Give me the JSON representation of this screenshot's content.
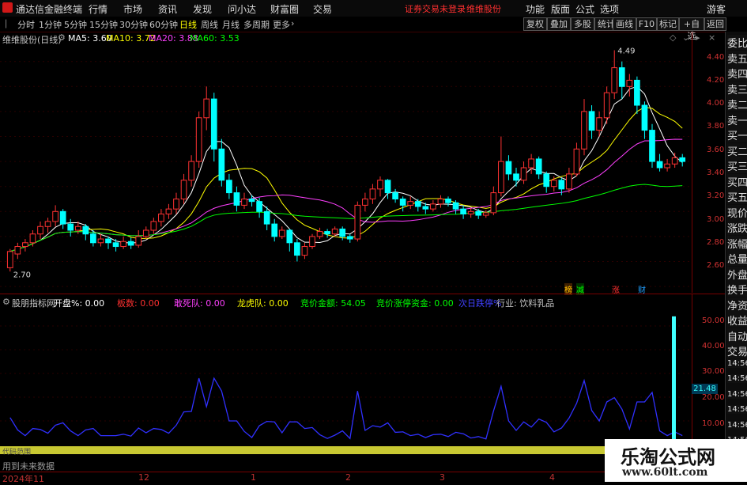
{
  "titlebar": {
    "app_name": "通达信金融终端",
    "menu": [
      "行情",
      "市场",
      "资讯",
      "发现",
      "问小达",
      "财富圈",
      "交易"
    ],
    "warning": "证券交易未登录",
    "stock": "维维股份",
    "right_menu": [
      "功能",
      "版面",
      "公式",
      "选项"
    ],
    "guest": "游客"
  },
  "toolbar": {
    "periods": [
      "分时",
      "1分钟",
      "5分钟",
      "15分钟",
      "30分钟",
      "60分钟",
      "日线",
      "周线",
      "月线",
      "多周期",
      "更多"
    ],
    "active": "日线",
    "right_buttons": [
      "复权",
      "叠加",
      "多股",
      "统计",
      "画线",
      "F10",
      "标记",
      "+自选",
      "返回"
    ]
  },
  "main_chart": {
    "title": "维维股份(日线)",
    "ma_labels": [
      {
        "text": "MA5: 3.60",
        "color": "#ffffff"
      },
      {
        "text": "MA10: 3.72",
        "color": "#ffff00"
      },
      {
        "text": "MA20: 3.88",
        "color": "#ff40ff"
      },
      {
        "text": "MA60: 3.53",
        "color": "#00ff00"
      }
    ],
    "high_label": "4.49",
    "low_label": "2.70",
    "price_axis": [
      "4.40",
      "4.20",
      "4.00",
      "3.80",
      "3.60",
      "3.40",
      "3.20",
      "3.00",
      "2.80",
      "2.60"
    ],
    "event_marks": [
      {
        "text": "榜",
        "color": "#ffc000"
      },
      {
        "text": "减",
        "color": "#00ff00"
      },
      {
        "text": "涨",
        "color": "#ff3030"
      },
      {
        "text": "财",
        "color": "#20a0ff"
      }
    ]
  },
  "right_panel": {
    "labels": [
      "委比",
      "卖五",
      "卖四",
      "卖三",
      "卖二",
      "卖一",
      "买一",
      "买二",
      "买三",
      "买四",
      "买五",
      "现价",
      "涨跌",
      "涨幅",
      "总量",
      "外盘",
      "换手",
      "净资",
      "收益",
      "自动",
      "交易",
      "14:56",
      "14:56",
      "14:56",
      "14:56",
      "14:56",
      "14:56",
      "14:56",
      "14:56"
    ]
  },
  "sub_chart": {
    "title": "股朋指标网",
    "fields": [
      {
        "text": "开盘%: 0.00",
        "color": "#ffffff"
      },
      {
        "text": "板数: 0.00",
        "color": "#ff3030"
      },
      {
        "text": "敢死队: 0.00",
        "color": "#ff40ff"
      },
      {
        "text": "龙虎队: 0.00",
        "color": "#ffff00"
      },
      {
        "text": "竞价金额: 54.05",
        "color": "#00ff00"
      },
      {
        "text": "竞价涨停资金: 0.00",
        "color": "#00ff00"
      },
      {
        "text": "次日跌停%",
        "color": "#4040ff"
      },
      {
        "text": "行业: 饮料乳品",
        "color": "#c0c0c0"
      }
    ],
    "axis": [
      "50.00",
      "40.00",
      "30.00",
      "20.00",
      "10.00"
    ],
    "current_value": "21.48",
    "strip_label": "代码范围",
    "future_note": "用到未来数据"
  },
  "x_axis": {
    "labels": [
      "2024年11",
      "12",
      "1",
      "2",
      "3",
      "4"
    ]
  },
  "watermark": {
    "line1": "乐淘公式网",
    "line2": "www.60lt.com"
  },
  "chart_data": {
    "type": "candlestick",
    "ylim": [
      2.55,
      4.55
    ],
    "candles": [
      [
        2.75,
        2.88,
        2.72,
        2.9
      ],
      [
        2.86,
        2.92,
        2.82,
        2.95
      ],
      [
        2.92,
        2.95,
        2.88,
        2.98
      ],
      [
        2.95,
        3.02,
        2.92,
        3.05
      ],
      [
        3.02,
        3.08,
        2.98,
        3.12
      ],
      [
        3.08,
        3.12,
        3.03,
        3.15
      ],
      [
        3.12,
        3.2,
        3.08,
        3.25
      ],
      [
        3.2,
        3.1,
        3.06,
        3.22
      ],
      [
        3.1,
        3.05,
        3.0,
        3.14
      ],
      [
        3.05,
        3.08,
        3.02,
        3.12
      ],
      [
        3.08,
        3.02,
        2.97,
        3.1
      ],
      [
        3.02,
        2.95,
        2.92,
        3.05
      ],
      [
        2.95,
        2.98,
        2.92,
        3.02
      ],
      [
        2.98,
        2.95,
        2.9,
        3.0
      ],
      [
        2.95,
        2.92,
        2.88,
        2.98
      ],
      [
        2.92,
        2.96,
        2.9,
        3.0
      ],
      [
        2.96,
        2.93,
        2.9,
        2.99
      ],
      [
        2.93,
        3.0,
        2.91,
        3.05
      ],
      [
        3.0,
        3.05,
        2.98,
        3.08
      ],
      [
        3.05,
        3.12,
        3.02,
        3.15
      ],
      [
        3.12,
        3.18,
        3.08,
        3.22
      ],
      [
        3.18,
        3.22,
        3.14,
        3.26
      ],
      [
        3.22,
        3.3,
        3.18,
        3.35
      ],
      [
        3.3,
        3.45,
        3.26,
        3.5
      ],
      [
        3.45,
        3.6,
        3.4,
        3.65
      ],
      [
        3.6,
        3.95,
        3.55,
        4.0
      ],
      [
        3.95,
        4.1,
        3.85,
        4.2
      ],
      [
        4.1,
        3.7,
        3.6,
        4.15
      ],
      [
        3.7,
        3.45,
        3.4,
        3.78
      ],
      [
        3.45,
        3.35,
        3.3,
        3.5
      ],
      [
        3.35,
        3.25,
        3.2,
        3.4
      ],
      [
        3.25,
        3.3,
        3.22,
        3.35
      ],
      [
        3.3,
        3.28,
        3.24,
        3.33
      ],
      [
        3.28,
        3.2,
        3.15,
        3.31
      ],
      [
        3.2,
        3.1,
        3.05,
        3.24
      ],
      [
        3.1,
        3.0,
        2.96,
        3.14
      ],
      [
        3.0,
        3.05,
        2.98,
        3.08
      ],
      [
        3.05,
        2.95,
        2.88,
        3.06
      ],
      [
        2.95,
        2.85,
        2.8,
        2.98
      ],
      [
        2.85,
        2.92,
        2.82,
        2.95
      ],
      [
        2.92,
        3.0,
        2.9,
        3.02
      ],
      [
        3.0,
        3.04,
        2.98,
        3.07
      ],
      [
        3.04,
        3.02,
        2.99,
        3.06
      ],
      [
        3.02,
        3.06,
        3.0,
        3.08
      ],
      [
        3.06,
        3.0,
        2.97,
        3.08
      ],
      [
        3.0,
        2.98,
        2.95,
        3.02
      ],
      [
        2.98,
        3.25,
        2.96,
        3.28
      ],
      [
        3.25,
        3.3,
        3.2,
        3.35
      ],
      [
        3.3,
        3.38,
        3.26,
        3.42
      ],
      [
        3.38,
        3.45,
        3.32,
        3.48
      ],
      [
        3.45,
        3.35,
        3.3,
        3.46
      ],
      [
        3.35,
        3.3,
        3.27,
        3.38
      ],
      [
        3.3,
        3.25,
        3.2,
        3.32
      ],
      [
        3.25,
        3.28,
        3.22,
        3.32
      ],
      [
        3.28,
        3.24,
        3.2,
        3.3
      ],
      [
        3.24,
        3.22,
        3.18,
        3.27
      ],
      [
        3.22,
        3.26,
        3.2,
        3.29
      ],
      [
        3.26,
        3.3,
        3.23,
        3.33
      ],
      [
        3.3,
        3.27,
        3.24,
        3.32
      ],
      [
        3.27,
        3.22,
        3.18,
        3.29
      ],
      [
        3.22,
        3.18,
        3.14,
        3.25
      ],
      [
        3.18,
        3.2,
        3.15,
        3.23
      ],
      [
        3.2,
        3.17,
        3.14,
        3.22
      ],
      [
        3.17,
        3.19,
        3.15,
        3.21
      ],
      [
        3.19,
        3.35,
        3.17,
        3.4
      ],
      [
        3.35,
        3.6,
        3.32,
        3.8
      ],
      [
        3.6,
        3.5,
        3.45,
        3.65
      ],
      [
        3.5,
        3.45,
        3.4,
        3.55
      ],
      [
        3.45,
        3.55,
        3.42,
        3.6
      ],
      [
        3.55,
        3.62,
        3.5,
        3.66
      ],
      [
        3.62,
        3.5,
        3.46,
        3.64
      ],
      [
        3.5,
        3.4,
        3.35,
        3.52
      ],
      [
        3.4,
        3.45,
        3.36,
        3.48
      ],
      [
        3.45,
        3.38,
        3.33,
        3.47
      ],
      [
        3.38,
        3.5,
        3.35,
        3.55
      ],
      [
        3.5,
        3.7,
        3.48,
        3.75
      ],
      [
        3.7,
        4.0,
        3.65,
        4.1
      ],
      [
        4.0,
        3.85,
        3.78,
        4.05
      ],
      [
        3.85,
        3.95,
        3.8,
        4.0
      ],
      [
        3.95,
        4.15,
        3.9,
        4.2
      ],
      [
        4.15,
        4.35,
        4.1,
        4.49
      ],
      [
        4.35,
        4.2,
        4.1,
        4.4
      ],
      [
        4.2,
        4.25,
        4.12,
        4.3
      ],
      [
        4.25,
        4.05,
        3.98,
        4.28
      ],
      [
        4.05,
        3.85,
        3.78,
        4.08
      ],
      [
        3.85,
        3.6,
        3.55,
        3.9
      ],
      [
        3.6,
        3.55,
        3.52,
        3.66
      ],
      [
        3.55,
        3.58,
        3.52,
        3.62
      ],
      [
        3.58,
        3.63,
        3.55,
        3.67
      ],
      [
        3.63,
        3.6,
        3.56,
        3.66
      ]
    ]
  }
}
